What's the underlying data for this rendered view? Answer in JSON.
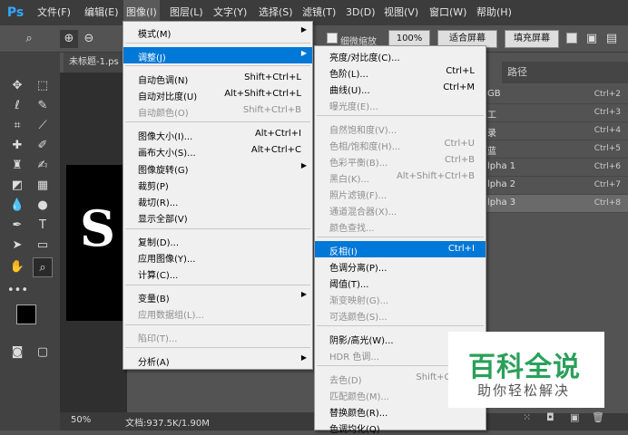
{
  "app": {
    "logo": "Ps"
  },
  "menubar": [
    {
      "label": "文件(F)"
    },
    {
      "label": "编辑(E)"
    },
    {
      "label": "图像(I)"
    },
    {
      "label": "图层(L)"
    },
    {
      "label": "文字(Y)"
    },
    {
      "label": "选择(S)"
    },
    {
      "label": "滤镜(T)"
    },
    {
      "label": "3D(D)"
    },
    {
      "label": "视图(V)"
    },
    {
      "label": "窗口(W)"
    },
    {
      "label": "帮助(H)"
    }
  ],
  "options": {
    "scrubby_zoom_label": "细微缩放",
    "zoom_value": "100%",
    "fit_screen_label": "适合屏幕",
    "fill_screen_label": "填充屏幕"
  },
  "document": {
    "tab_title": "未标题-1.ps",
    "canvas_letter": "S"
  },
  "status": {
    "zoom": "50%",
    "doc_size": "文档:937.5K/1.90M"
  },
  "channels_panel": {
    "tab_visible": "路径",
    "rows": [
      {
        "name": "GB",
        "shortcut": "Ctrl+2"
      },
      {
        "name": "工",
        "shortcut": "Ctrl+3"
      },
      {
        "name": "录",
        "shortcut": "Ctrl+4"
      },
      {
        "name": "蓝",
        "shortcut": "Ctrl+5"
      },
      {
        "name": "lpha 1",
        "shortcut": "Ctrl+6"
      },
      {
        "name": "lpha 2",
        "shortcut": "Ctrl+7"
      },
      {
        "name": "lpha 3",
        "shortcut": "Ctrl+8"
      }
    ]
  },
  "image_menu": [
    {
      "label": "模式(M)",
      "key": "",
      "submenu": true,
      "disabled": false
    },
    {
      "label": "调整(J)",
      "key": "",
      "submenu": true,
      "disabled": false,
      "highlight": true
    },
    {
      "label": "自动色调(N)",
      "key": "Shift+Ctrl+L",
      "disabled": false
    },
    {
      "label": "自动对比度(U)",
      "key": "Alt+Shift+Ctrl+L",
      "disabled": false
    },
    {
      "label": "自动颜色(O)",
      "key": "Shift+Ctrl+B",
      "disabled": true
    },
    {
      "label": "图像大小(I)...",
      "key": "Alt+Ctrl+I",
      "disabled": false
    },
    {
      "label": "画布大小(S)...",
      "key": "Alt+Ctrl+C",
      "disabled": false
    },
    {
      "label": "图像旋转(G)",
      "key": "",
      "submenu": true,
      "disabled": false
    },
    {
      "label": "裁剪(P)",
      "key": "",
      "disabled": false
    },
    {
      "label": "裁切(R)...",
      "key": "",
      "disabled": false
    },
    {
      "label": "显示全部(V)",
      "key": "",
      "disabled": false
    },
    {
      "label": "复制(D)...",
      "key": "",
      "disabled": false
    },
    {
      "label": "应用图像(Y)...",
      "key": "",
      "disabled": false
    },
    {
      "label": "计算(C)...",
      "key": "",
      "disabled": false
    },
    {
      "label": "变量(B)",
      "key": "",
      "submenu": true,
      "disabled": false
    },
    {
      "label": "应用数据组(L)...",
      "key": "",
      "disabled": true
    },
    {
      "label": "陷印(T)...",
      "key": "",
      "disabled": true
    },
    {
      "label": "分析(A)",
      "key": "",
      "submenu": true,
      "disabled": false
    }
  ],
  "adjust_menu": [
    {
      "label": "亮度/对比度(C)...",
      "key": "",
      "disabled": false
    },
    {
      "label": "色阶(L)...",
      "key": "Ctrl+L",
      "disabled": false
    },
    {
      "label": "曲线(U)...",
      "key": "Ctrl+M",
      "disabled": false
    },
    {
      "label": "曝光度(E)...",
      "key": "",
      "disabled": true
    },
    {
      "label": "自然饱和度(V)...",
      "key": "",
      "disabled": true
    },
    {
      "label": "色相/饱和度(H)...",
      "key": "Ctrl+U",
      "disabled": true
    },
    {
      "label": "色彩平衡(B)...",
      "key": "Ctrl+B",
      "disabled": true
    },
    {
      "label": "黑白(K)...",
      "key": "Alt+Shift+Ctrl+B",
      "disabled": true
    },
    {
      "label": "照片滤镜(F)...",
      "key": "",
      "disabled": true
    },
    {
      "label": "通道混合器(X)...",
      "key": "",
      "disabled": true
    },
    {
      "label": "颜色查找...",
      "key": "",
      "disabled": true
    },
    {
      "label": "反相(I)",
      "key": "Ctrl+I",
      "disabled": false,
      "highlight": true
    },
    {
      "label": "色调分离(P)...",
      "key": "",
      "disabled": false
    },
    {
      "label": "阈值(T)...",
      "key": "",
      "disabled": false
    },
    {
      "label": "渐变映射(G)...",
      "key": "",
      "disabled": true
    },
    {
      "label": "可选颜色(S)...",
      "key": "",
      "disabled": true
    },
    {
      "label": "阴影/高光(W)...",
      "key": "",
      "disabled": false
    },
    {
      "label": "HDR 色调...",
      "key": "",
      "disabled": true
    },
    {
      "label": "去色(D)",
      "key": "Shift+Ctrl+U",
      "disabled": true
    },
    {
      "label": "匹配颜色(M)...",
      "key": "",
      "disabled": true
    },
    {
      "label": "替换颜色(R)...",
      "key": "",
      "disabled": false
    },
    {
      "label": "色调均化(Q)",
      "key": "",
      "disabled": false
    }
  ],
  "watermark": {
    "title": "百科全说",
    "subtitle": "助你轻松解决"
  },
  "colors": {
    "accent": "#0078d7",
    "menu_bg": "#f0f0f0",
    "app_bg": "#535353"
  }
}
